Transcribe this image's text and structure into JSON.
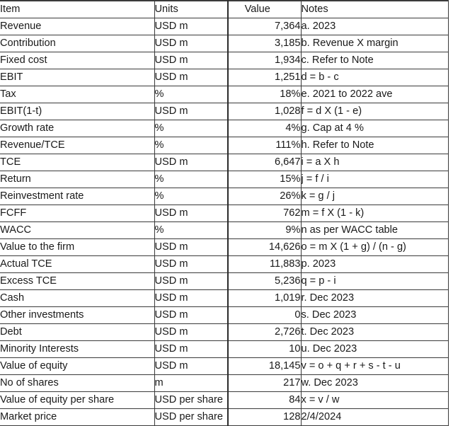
{
  "table": {
    "columns": [
      "Item",
      "Units",
      "Value",
      "Notes"
    ],
    "rows": [
      {
        "item": "Revenue",
        "units": "USD m",
        "value": "7,364",
        "notes": "a. 2023"
      },
      {
        "item": "Contribution",
        "units": "USD m",
        "value": "3,185",
        "notes": "b. Revenue X margin"
      },
      {
        "item": "Fixed cost",
        "units": "USD m",
        "value": "1,934",
        "notes": "c. Refer to Note"
      },
      {
        "item": "EBIT",
        "units": "USD m",
        "value": "1,251",
        "notes": "d = b - c"
      },
      {
        "item": "Tax",
        "units": "%",
        "value": "18%",
        "notes": "e. 2021 to 2022 ave"
      },
      {
        "item": "EBIT(1-t)",
        "units": "USD m",
        "value": "1,028",
        "notes": "f = d X (1 - e)"
      },
      {
        "item": "Growth rate",
        "units": "%",
        "value": "4%",
        "notes": "g. Cap at 4 %"
      },
      {
        "item": "Revenue/TCE",
        "units": "%",
        "value": "111%",
        "notes": "h. Refer to Note"
      },
      {
        "item": "TCE",
        "units": "USD m",
        "value": "6,647",
        "notes": "i = a X h"
      },
      {
        "item": "Return",
        "units": "%",
        "value": "15%",
        "notes": "j = f / i"
      },
      {
        "item": "Reinvestment rate",
        "units": "%",
        "value": "26%",
        "notes": "k = g / j"
      },
      {
        "item": "FCFF",
        "units": "USD m",
        "value": "762",
        "notes": "m = f X (1 - k)"
      },
      {
        "item": "WACC",
        "units": "%",
        "value": "9%",
        "notes": "n as per WACC table"
      },
      {
        "item": "Value to the firm",
        "units": "USD m",
        "value": "14,626",
        "notes": "o = m X (1 + g) / (n - g)"
      },
      {
        "item": "Actual TCE",
        "units": "USD m",
        "value": "11,883",
        "notes": "p. 2023"
      },
      {
        "item": "Excess TCE",
        "units": "USD m",
        "value": "5,236",
        "notes": "q = p - i"
      },
      {
        "item": "Cash",
        "units": "USD m",
        "value": "1,019",
        "notes": "r. Dec 2023"
      },
      {
        "item": "Other investments",
        "units": "USD m",
        "value": "0",
        "notes": "s. Dec 2023"
      },
      {
        "item": "Debt",
        "units": "USD m",
        "value": "2,726",
        "notes": "t. Dec 2023"
      },
      {
        "item": "Minority Interests",
        "units": "USD m",
        "value": "10",
        "notes": "u. Dec 2023"
      },
      {
        "item": "Value of equity",
        "units": "USD m",
        "value": "18,145",
        "notes": "v = o + q + r + s - t - u"
      },
      {
        "item": "No of shares",
        "units": "m",
        "value": "217",
        "notes": "w. Dec 2023"
      },
      {
        "item": "Value of equity per share",
        "units": "USD per share",
        "value": "84",
        "notes": "x = v / w"
      },
      {
        "item": "Market price",
        "units": "USD per share",
        "value": "128",
        "notes": "2/4/2024"
      }
    ]
  }
}
